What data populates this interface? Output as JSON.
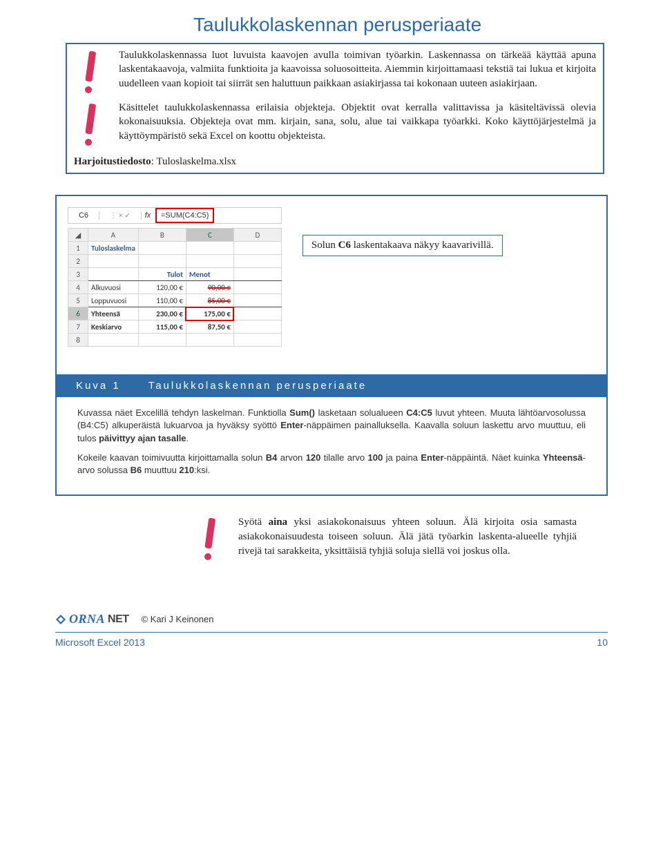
{
  "title": "Taulukkolaskennan perusperiaate",
  "intro": {
    "p1": "Taulukkolaskennassa luot luvuista kaavojen avulla toimivan työarkin. Laskennassa on tärkeää käyttää apuna laskentakaavoja, valmiita funktioita ja kaavoissa soluosoitteita. Aiemmin kirjoittamaasi tekstiä tai lukua et kirjoita uudelleen vaan kopioit tai siirrät sen haluttuun paikkaan asiakirjassa tai kokonaan uuteen asiakirjaan.",
    "p2": "Käsittelet taulukkolaskennassa erilaisia objekteja. Objektit ovat kerralla valittavissa ja käsiteltävissä olevia kokonaisuuksia. Objekteja ovat mm. kirjain, sana, solu, alue tai vaikkapa työarkki. Koko käyttöjärjestelmä ja käyttöympäristö sekä Excel on koottu objekteista.",
    "harjoitus_label": "Harjoitustiedosto",
    "harjoitus_value": ": Tuloslaskelma.xlsx"
  },
  "excel": {
    "name_box": "C6",
    "fx_icons": "⋮   ×   ✓",
    "fx_label": "fx",
    "formula": "=SUM(C4:C5)",
    "cols": [
      "A",
      "B",
      "C",
      "D"
    ],
    "rows": [
      "1",
      "2",
      "3",
      "4",
      "5",
      "6",
      "7",
      "8"
    ],
    "r1a": "Tuloslaskelma",
    "r3b": "Tulot",
    "r3c": "Menot",
    "r4a": "Alkuvuosi",
    "r4b": "120,00 €",
    "r4c": "90,00 €",
    "r5a": "Loppuvuosi",
    "r5b": "110,00 €",
    "r5c": "85,00 €",
    "r6a": "Yhteensä",
    "r6b": "230,00 €",
    "r6c": "175,00 €",
    "r7a": "Keskiarvo",
    "r7b": "115,00 €",
    "r7c": "87,50 €"
  },
  "callout": "Solun C6 laskentakaava näkyy kaavarivillä.",
  "caption": {
    "label": "Kuva 1",
    "title": "Taulukkolaskennan perusperiaate"
  },
  "desc": {
    "p1_a": "Kuvassa näet Excelillä tehdyn laskelman. Funktiolla ",
    "p1_b": "Sum()",
    "p1_c": " lasketaan solualueen ",
    "p1_d": "C4:C5",
    "p1_e": " luvut yhteen. Muuta lähtöarvosolussa (B4:C5) alkuperäistä lukuarvoa ja hyväksy syöttö ",
    "p1_f": "Enter",
    "p1_g": "-näppäimen painalluksella. Kaavalla soluun laskettu arvo muuttuu, eli tulos ",
    "p1_h": "päivittyy ajan tasalle",
    "p1_i": ".",
    "p2_a": "Kokeile kaavan toimivuutta kirjoittamalla solun ",
    "p2_b": "B4",
    "p2_c": " arvon ",
    "p2_d": "120",
    "p2_e": " tilalle arvo ",
    "p2_f": "100",
    "p2_g": " ja paina ",
    "p2_h": "Enter",
    "p2_i": "-näppäintä. Näet kuinka ",
    "p2_j": "Yhteensä",
    "p2_k": "-arvo solussa ",
    "p2_l": "B6",
    "p2_m": " muuttuu ",
    "p2_n": "210",
    "p2_o": ":ksi."
  },
  "tip": "Syötä aina yksi asiakokonaisuus yhteen soluun. Älä kirjoita osia samasta asiakokonaisuudesta toiseen soluun. Älä jätä työarkin laskenta-alueelle tyhjiä rivejä tai sarakkeita, yksittäisiä tyhjiä soluja siellä voi joskus olla.",
  "tip_bold": "aina",
  "footer": {
    "logo_orna": "ORNA",
    "logo_net": "NET",
    "copy": "© Kari J Keinonen",
    "left": "Microsoft Excel 2013",
    "right": "10"
  }
}
